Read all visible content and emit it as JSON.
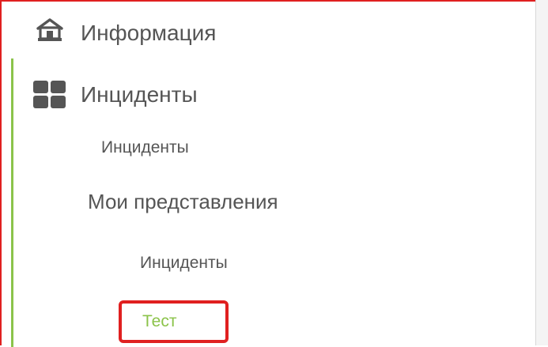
{
  "sidebar": {
    "home": {
      "label": "Информация",
      "icon": "home-icon"
    },
    "incidents": {
      "label": "Инциденты",
      "icon": "grid-icon",
      "children": {
        "incidents_link": "Инциденты",
        "my_views_label": "Мои представления",
        "my_views_items": [
          "Инциденты",
          "Тест"
        ]
      }
    }
  },
  "colors": {
    "text": "#555555",
    "accent_green": "#8bc34a",
    "highlight_red": "#e02020"
  }
}
